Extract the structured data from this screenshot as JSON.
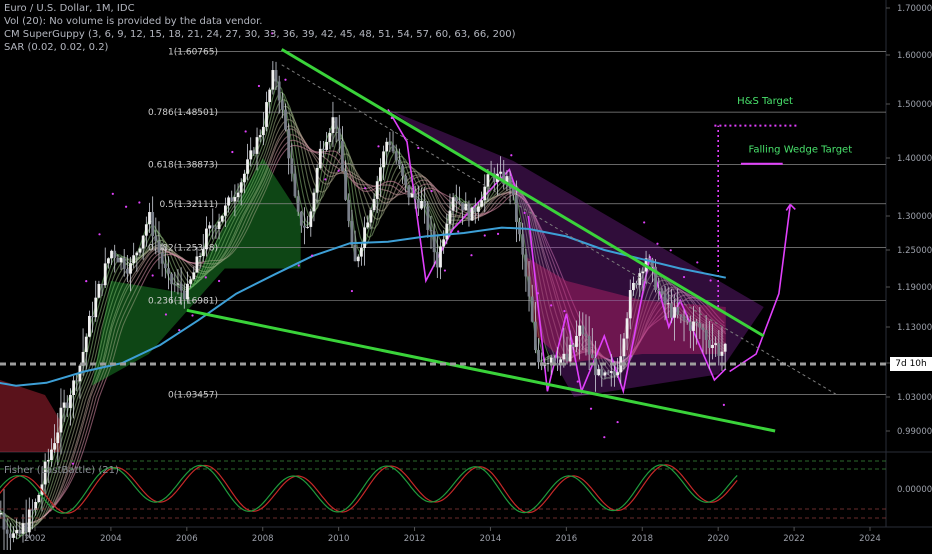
{
  "header": {
    "symbol_line": "Euro / U.S. Dollar, 1M, IDC",
    "volume_line": "Vol (20): No volume is provided by the data vendor.",
    "guppy_line": "CM SuperGuppy (3, 6, 9, 12, 15, 18, 21, 24, 27, 30, 33, 36, 39, 42, 45, 48, 51, 54, 57, 60, 63, 66, 200)",
    "sar_line": "SAR (0.02, 0.02, 0.2)"
  },
  "price_tag": "7d 10h",
  "fisher_label": "Fisher (LastBattle) (21)",
  "colors": {
    "background": "#000000",
    "trendline_green": "#3ad33a",
    "pattern_magenta": "#e040fb",
    "ma200_blue": "#3d9fd6",
    "target_text": "#49e26c",
    "fisher_green": "#1f9b3d",
    "fisher_red": "#c62828"
  },
  "chart_data": {
    "type": "candlestick",
    "x_axis": {
      "ticks": [
        "2002",
        "2004",
        "2006",
        "2008",
        "2010",
        "2012",
        "2014",
        "2016",
        "2018",
        "2020",
        "2022",
        "2024"
      ],
      "range": [
        2000.6,
        2024.7
      ]
    },
    "y_axis": {
      "ticks": [
        "0.99000",
        "1.03000",
        "1.09000",
        "1.13000",
        "1.19000",
        "1.25000",
        "1.30000",
        "1.40000",
        "1.50000",
        "1.60000",
        "1.70000"
      ],
      "range": [
        0.955,
        1.71
      ]
    },
    "fib_levels": [
      {
        "label": "1(1.60765)",
        "value": 1.60765
      },
      {
        "label": "0.786(1.48501)",
        "value": 1.48501
      },
      {
        "label": "0.618(1.38873)",
        "value": 1.38873
      },
      {
        "label": "0.5(1.32111)",
        "value": 1.32111
      },
      {
        "label": "0.382(1.25348)",
        "value": 1.25348
      },
      {
        "label": "0.236(1.16981)",
        "value": 1.16981
      },
      {
        "label": "0(1.03457)",
        "value": 1.03457
      }
    ],
    "close_series": [
      [
        2000.6,
        0.88
      ],
      [
        2001.0,
        0.9
      ],
      [
        2001.5,
        0.86
      ],
      [
        2002.0,
        0.9
      ],
      [
        2002.5,
        0.98
      ],
      [
        2003.0,
        1.05
      ],
      [
        2003.5,
        1.15
      ],
      [
        2004.0,
        1.25
      ],
      [
        2004.5,
        1.22
      ],
      [
        2005.0,
        1.3
      ],
      [
        2005.5,
        1.2
      ],
      [
        2006.0,
        1.18
      ],
      [
        2006.5,
        1.27
      ],
      [
        2007.0,
        1.31
      ],
      [
        2007.5,
        1.37
      ],
      [
        2008.0,
        1.46
      ],
      [
        2008.3,
        1.57
      ],
      [
        2008.6,
        1.45
      ],
      [
        2008.9,
        1.3
      ],
      [
        2009.2,
        1.28
      ],
      [
        2009.5,
        1.41
      ],
      [
        2009.9,
        1.48
      ],
      [
        2010.4,
        1.22
      ],
      [
        2010.9,
        1.33
      ],
      [
        2011.3,
        1.44
      ],
      [
        2011.8,
        1.34
      ],
      [
        2012.2,
        1.32
      ],
      [
        2012.6,
        1.23
      ],
      [
        2013.0,
        1.34
      ],
      [
        2013.5,
        1.3
      ],
      [
        2014.0,
        1.37
      ],
      [
        2014.5,
        1.36
      ],
      [
        2014.9,
        1.22
      ],
      [
        2015.2,
        1.09
      ],
      [
        2015.6,
        1.1
      ],
      [
        2016.0,
        1.09
      ],
      [
        2016.4,
        1.13
      ],
      [
        2016.9,
        1.06
      ],
      [
        2017.3,
        1.07
      ],
      [
        2017.7,
        1.18
      ],
      [
        2018.1,
        1.24
      ],
      [
        2018.5,
        1.17
      ],
      [
        2019.0,
        1.14
      ],
      [
        2019.5,
        1.13
      ],
      [
        2019.9,
        1.11
      ],
      [
        2020.2,
        1.1
      ]
    ],
    "ma200_series": [
      [
        2000.6,
        1.06
      ],
      [
        2001.5,
        1.05
      ],
      [
        2002.3,
        1.055
      ],
      [
        2003.3,
        1.075
      ],
      [
        2004.3,
        1.09
      ],
      [
        2005.3,
        1.11
      ],
      [
        2006.3,
        1.14
      ],
      [
        2007.3,
        1.18
      ],
      [
        2008.3,
        1.21
      ],
      [
        2009.3,
        1.24
      ],
      [
        2010.3,
        1.26
      ],
      [
        2011.3,
        1.262
      ],
      [
        2012.3,
        1.27
      ],
      [
        2013.3,
        1.275
      ],
      [
        2014.3,
        1.283
      ],
      [
        2015.0,
        1.281
      ],
      [
        2016.0,
        1.27
      ],
      [
        2017.0,
        1.25
      ],
      [
        2018.0,
        1.235
      ],
      [
        2019.0,
        1.22
      ],
      [
        2020.2,
        1.205
      ]
    ],
    "trendlines": [
      {
        "name": "upper-resistance",
        "points": [
          [
            2008.5,
            1.612
          ],
          [
            2021.2,
            1.12
          ]
        ]
      },
      {
        "name": "lower-support",
        "points": [
          [
            2006.0,
            1.155
          ],
          [
            2021.5,
            0.99
          ]
        ]
      },
      {
        "name": "inner-dashed",
        "points": [
          [
            2008.5,
            1.58
          ],
          [
            2023.1,
            1.035
          ]
        ]
      }
    ],
    "annotations": [
      {
        "text": "H&S Target",
        "x": 2020.5,
        "y": 1.5
      },
      {
        "text": "Falling Wedge Target",
        "x": 2020.8,
        "y": 1.41
      }
    ],
    "fisher_ticks": [
      "0.00000"
    ]
  }
}
